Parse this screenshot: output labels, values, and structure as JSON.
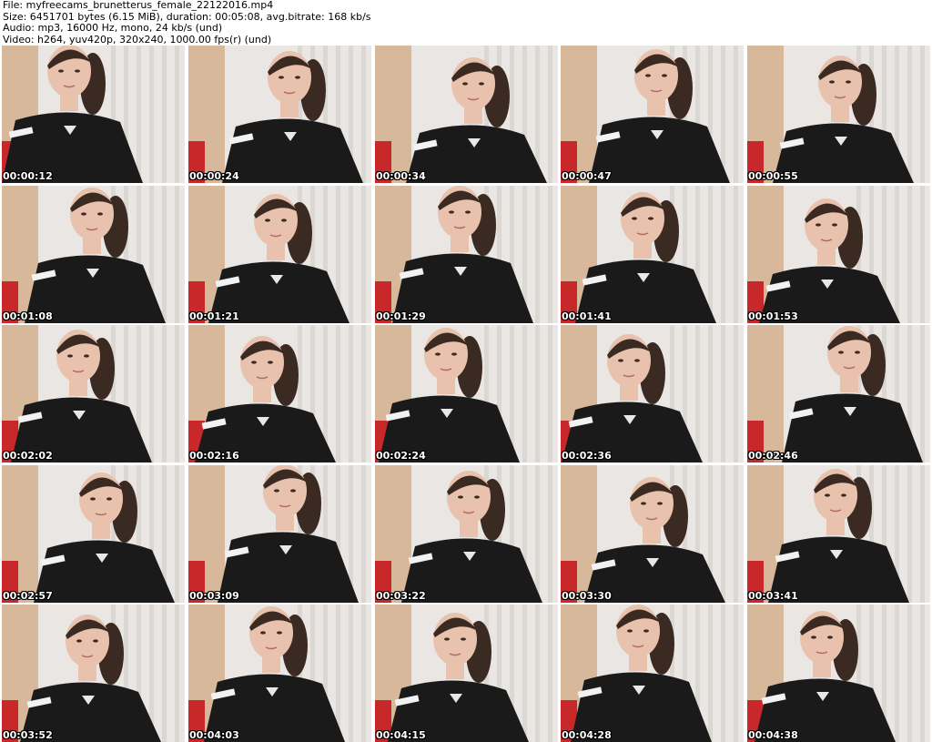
{
  "header": {
    "file_line": "File: myfreecams_brunetterus_female_22122016.mp4",
    "size_line": "Size: 6451701 bytes (6.15 MiB), duration: 00:05:08, avg.bitrate: 168 kb/s",
    "audio_line": "Audio: mp3, 16000 Hz, mono, 24 kb/s (und)",
    "video_line": "Video: h264, yuv420p, 320x240, 1000.00 fps(r) (und)"
  },
  "thumbnails": [
    {
      "timestamp": "00:00:12"
    },
    {
      "timestamp": "00:00:24"
    },
    {
      "timestamp": "00:00:34"
    },
    {
      "timestamp": "00:00:47"
    },
    {
      "timestamp": "00:00:55"
    },
    {
      "timestamp": "00:01:08"
    },
    {
      "timestamp": "00:01:21"
    },
    {
      "timestamp": "00:01:29"
    },
    {
      "timestamp": "00:01:41"
    },
    {
      "timestamp": "00:01:53"
    },
    {
      "timestamp": "00:02:02"
    },
    {
      "timestamp": "00:02:16"
    },
    {
      "timestamp": "00:02:24"
    },
    {
      "timestamp": "00:02:36"
    },
    {
      "timestamp": "00:02:46"
    },
    {
      "timestamp": "00:02:57"
    },
    {
      "timestamp": "00:03:09"
    },
    {
      "timestamp": "00:03:22"
    },
    {
      "timestamp": "00:03:30"
    },
    {
      "timestamp": "00:03:41"
    },
    {
      "timestamp": "00:03:52"
    },
    {
      "timestamp": "00:04:03"
    },
    {
      "timestamp": "00:04:15"
    },
    {
      "timestamp": "00:04:28"
    },
    {
      "timestamp": "00:04:38"
    }
  ],
  "colors": {
    "curtain": "#e9e6e3",
    "wall": "#d8b89a",
    "chair": "#c8282a",
    "shirt": "#1a1a1a",
    "skin": "#e8c2ad",
    "hair": "#3a2a22",
    "timestamp_text": "#ffffff"
  }
}
